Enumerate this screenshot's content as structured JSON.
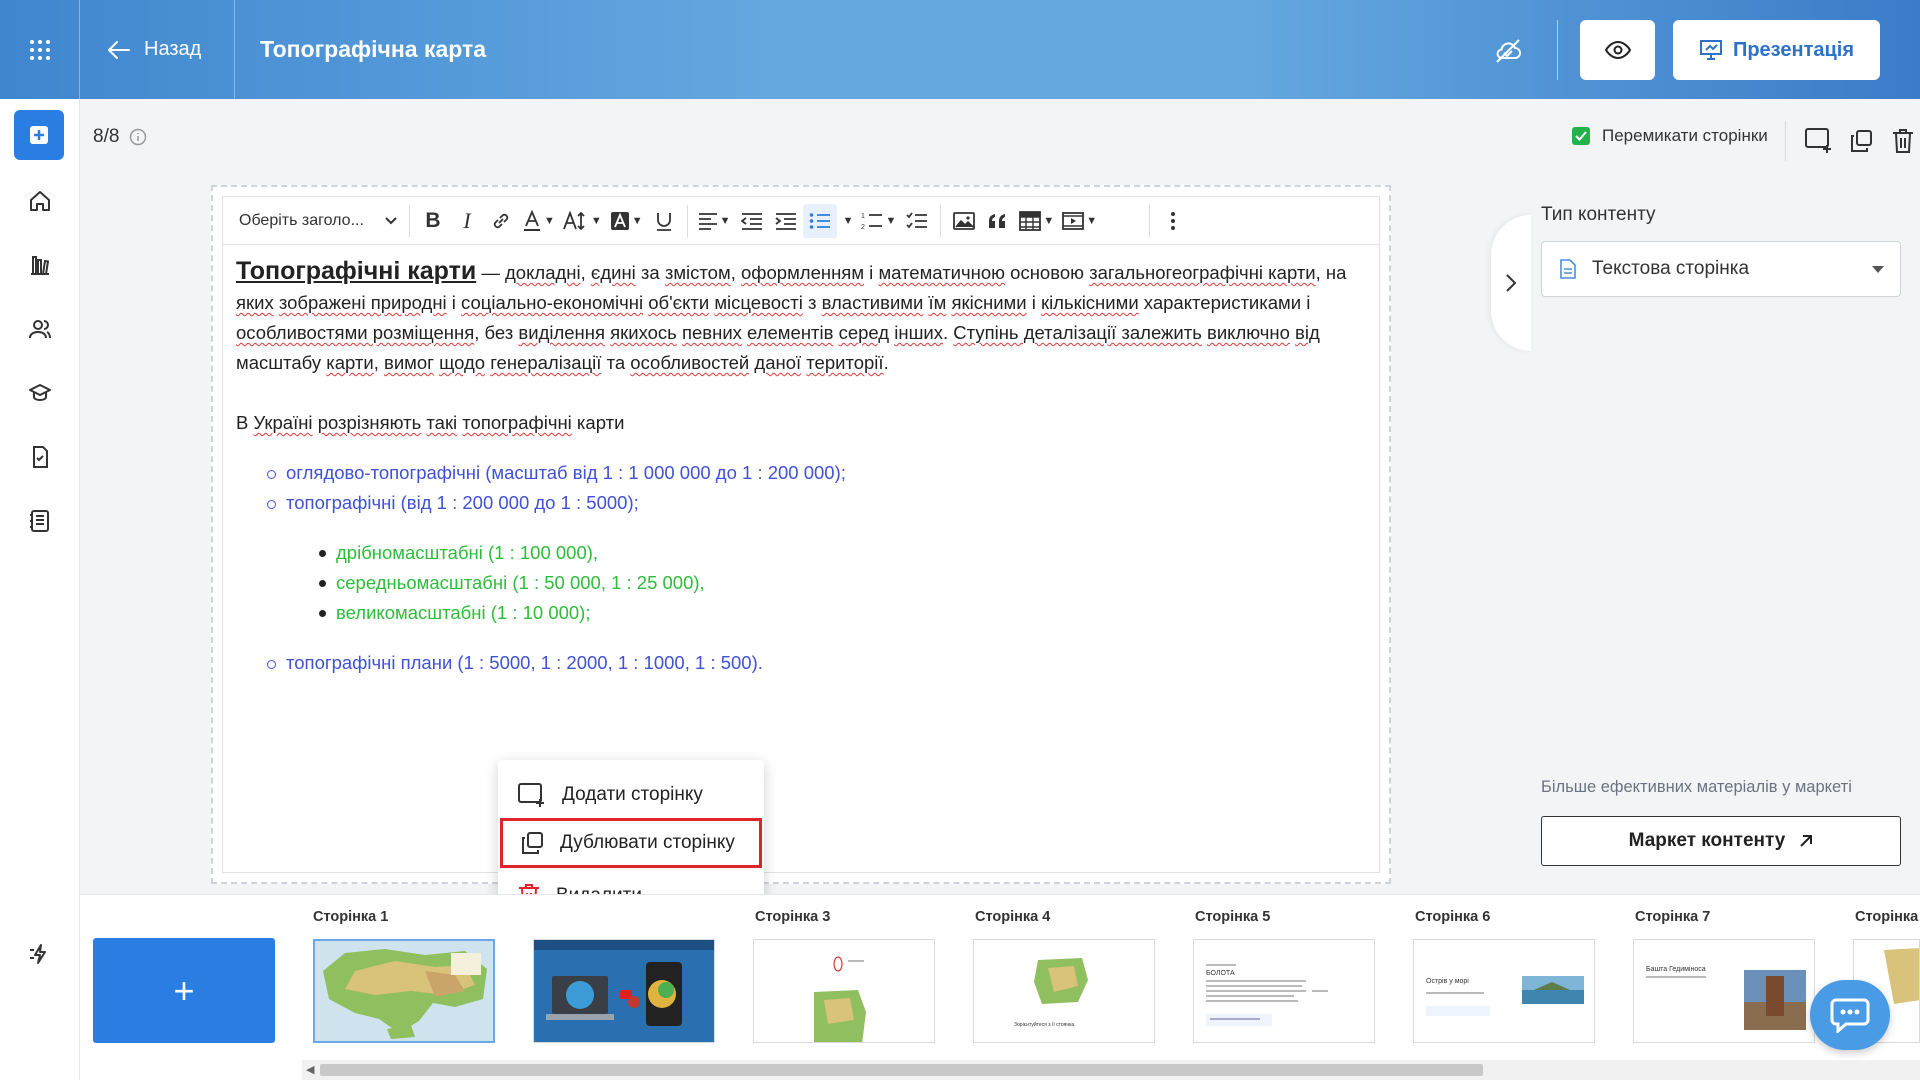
{
  "header": {
    "back_label": "Назад",
    "title": "Топографічна карта",
    "presentation_label": "Презентація"
  },
  "subbar": {
    "page_counter": "8/8",
    "switch_pages_label": "Перемикати сторінки",
    "switch_pages_checked": true
  },
  "toolbar": {
    "heading_select": "Оберіть заголо..."
  },
  "content": {
    "title": "Топографічні карти",
    "p1_rest": [
      {
        "t": " — ",
        "s": false
      },
      {
        "t": "докладні",
        "s": true
      },
      {
        "t": ", ",
        "s": false
      },
      {
        "t": "єдині",
        "s": true
      },
      {
        "t": " за ",
        "s": false
      },
      {
        "t": "змістом",
        "s": true
      },
      {
        "t": ", ",
        "s": false
      },
      {
        "t": "оформленням",
        "s": true
      },
      {
        "t": " і ",
        "s": false
      },
      {
        "t": "математичною",
        "s": true
      },
      {
        "t": " основою ",
        "s": false
      },
      {
        "t": "загальногеографічні карти",
        "s": true
      },
      {
        "t": ", на ",
        "s": false
      },
      {
        "t": "яких",
        "s": true
      },
      {
        "t": " ",
        "s": false
      },
      {
        "t": "зображені природні",
        "s": true
      },
      {
        "t": " і ",
        "s": false
      },
      {
        "t": "соціально-економічні",
        "s": true
      },
      {
        "t": " ",
        "s": false
      },
      {
        "t": "об'єкти",
        "s": true
      },
      {
        "t": " ",
        "s": false
      },
      {
        "t": "місцевості",
        "s": true
      },
      {
        "t": " з ",
        "s": false
      },
      {
        "t": "властивими",
        "s": true
      },
      {
        "t": " ",
        "s": false
      },
      {
        "t": "їм",
        "s": true
      },
      {
        "t": " ",
        "s": false
      },
      {
        "t": "якісними",
        "s": true
      },
      {
        "t": " і ",
        "s": false
      },
      {
        "t": "кількісними",
        "s": true
      },
      {
        "t": " характеристиками і ",
        "s": false
      },
      {
        "t": "особливостями розміщення",
        "s": true
      },
      {
        "t": ", без ",
        "s": false
      },
      {
        "t": "виділення",
        "s": true
      },
      {
        "t": " ",
        "s": false
      },
      {
        "t": "якихось",
        "s": true
      },
      {
        "t": " ",
        "s": false
      },
      {
        "t": "певних",
        "s": true
      },
      {
        "t": " ",
        "s": false
      },
      {
        "t": "елементів",
        "s": true
      },
      {
        "t": " ",
        "s": false
      },
      {
        "t": "серед",
        "s": true
      },
      {
        "t": " ",
        "s": false
      },
      {
        "t": "інших",
        "s": true
      },
      {
        "t": ". ",
        "s": false
      },
      {
        "t": "Ступінь деталізації залежить",
        "s": true
      },
      {
        "t": " ",
        "s": false
      },
      {
        "t": "виключно",
        "s": true
      },
      {
        "t": " ",
        "s": false
      },
      {
        "t": "від",
        "s": true
      },
      {
        "t": " масштабу ",
        "s": false
      },
      {
        "t": "карти",
        "s": true
      },
      {
        "t": ", ",
        "s": false
      },
      {
        "t": "вимог",
        "s": true
      },
      {
        "t": " ",
        "s": false
      },
      {
        "t": "щодо",
        "s": true
      },
      {
        "t": " ",
        "s": false
      },
      {
        "t": "генералізації",
        "s": true
      },
      {
        "t": " та ",
        "s": false
      },
      {
        "t": "особливостей",
        "s": true
      },
      {
        "t": " ",
        "s": false
      },
      {
        "t": "даної",
        "s": true
      },
      {
        "t": " ",
        "s": false
      },
      {
        "t": "території",
        "s": true
      },
      {
        "t": ".",
        "s": false
      }
    ],
    "p2": [
      {
        "t": "В ",
        "s": false
      },
      {
        "t": "Україні",
        "s": true
      },
      {
        "t": " ",
        "s": false
      },
      {
        "t": "розрізняють",
        "s": true
      },
      {
        "t": " ",
        "s": false
      },
      {
        "t": "такі",
        "s": true
      },
      {
        "t": " ",
        "s": false
      },
      {
        "t": "топографічні",
        "s": true
      },
      {
        "t": " карти",
        "s": false
      }
    ],
    "list1": [
      "оглядово-топографічні (масштаб від 1 : 1 000 000 до 1 : 200 000);",
      "топографічні (від 1 : 200 000 до 1 : 5000);"
    ],
    "list2": [
      "дрібномасштабні (1 : 100 000),",
      "середньомасштабні (1 : 50 000, 1 : 25 000),",
      "великомасштабні (1 : 10 000);"
    ],
    "list3": [
      "топографічні плани (1 : 5000, 1 : 2000, 1 : 1000, 1 : 500)."
    ]
  },
  "context_menu": {
    "add_page": "Додати сторінку",
    "duplicate_page": "Дублювати сторінку",
    "delete": "Видалити"
  },
  "right_panel": {
    "content_type_label": "Тип контенту",
    "content_type_value": "Текстова сторінка",
    "market_hint": "Більше ефективних матеріалів у маркеті",
    "market_button": "Маркет контенту"
  },
  "pages": {
    "add_label": "+",
    "labels": [
      "Сторінка 1",
      "Сторінка 3",
      "Сторінка 4",
      "Сторінка 5",
      "Сторінка 6",
      "Сторінка 7",
      "Сторінка"
    ],
    "thumb_texts": {
      "p5_heading": "БОЛОТА",
      "p6_heading": "Острів у морі",
      "p7_heading": "Башта Гедиміноса",
      "p4_caption": "Зорієнтуйтеся з її стоянка."
    }
  },
  "colors": {
    "accent": "#2a7de1",
    "header_gradient_start": "#3f86cf",
    "list_blue": "#3f51d6",
    "list_green": "#2ebd3b",
    "highlight_red": "#e1232d",
    "checkbox_green": "#22b24c"
  }
}
